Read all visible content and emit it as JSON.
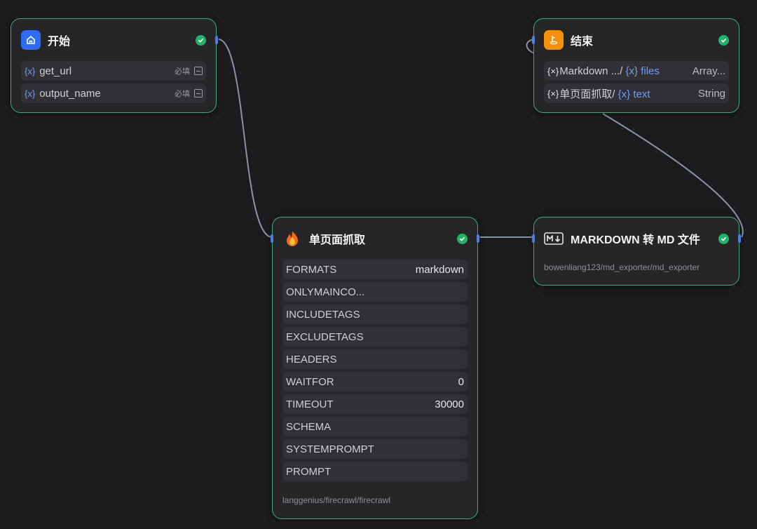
{
  "nodes": {
    "start": {
      "title": "开始",
      "icon": "home-icon",
      "status": "success",
      "variables": [
        {
          "name": "get_url",
          "required": "必填"
        },
        {
          "name": "output_name",
          "required": "必填"
        }
      ]
    },
    "end": {
      "title": "结束",
      "icon": "flag-icon",
      "status": "success",
      "outputs": [
        {
          "source": "Markdown ...",
          "sep": "/",
          "var": "files",
          "type": "Array..."
        },
        {
          "source": "单页面抓取",
          "sep": "/",
          "var": "text",
          "type": "String"
        }
      ]
    },
    "scrape": {
      "title": "单页面抓取",
      "icon": "fire-icon",
      "status": "success",
      "params": [
        {
          "key": "FORMATS",
          "value": "markdown"
        },
        {
          "key": "ONLYMAINCO...",
          "value": ""
        },
        {
          "key": "INCLUDETAGS",
          "value": ""
        },
        {
          "key": "EXCLUDETAGS",
          "value": ""
        },
        {
          "key": "HEADERS",
          "value": ""
        },
        {
          "key": "WAITFOR",
          "value": "0"
        },
        {
          "key": "TIMEOUT",
          "value": "30000"
        },
        {
          "key": "SCHEMA",
          "value": ""
        },
        {
          "key": "SYSTEMPROMPT",
          "value": ""
        },
        {
          "key": "PROMPT",
          "value": ""
        }
      ],
      "footer": "langgenius/firecrawl/firecrawl"
    },
    "markdown": {
      "title": "MARKDOWN 转 MD 文件",
      "icon": "markdown-icon",
      "status": "success",
      "footer": "bowenliang123/md_exporter/md_exporter"
    }
  },
  "colors": {
    "accent_border": "#3fae7c",
    "success": "#22b26a",
    "start_icon_bg": "#2f6cf6",
    "end_icon_bg": "#f79009",
    "edge": "#8a93a6",
    "variable_blue": "#6f9cf5"
  }
}
